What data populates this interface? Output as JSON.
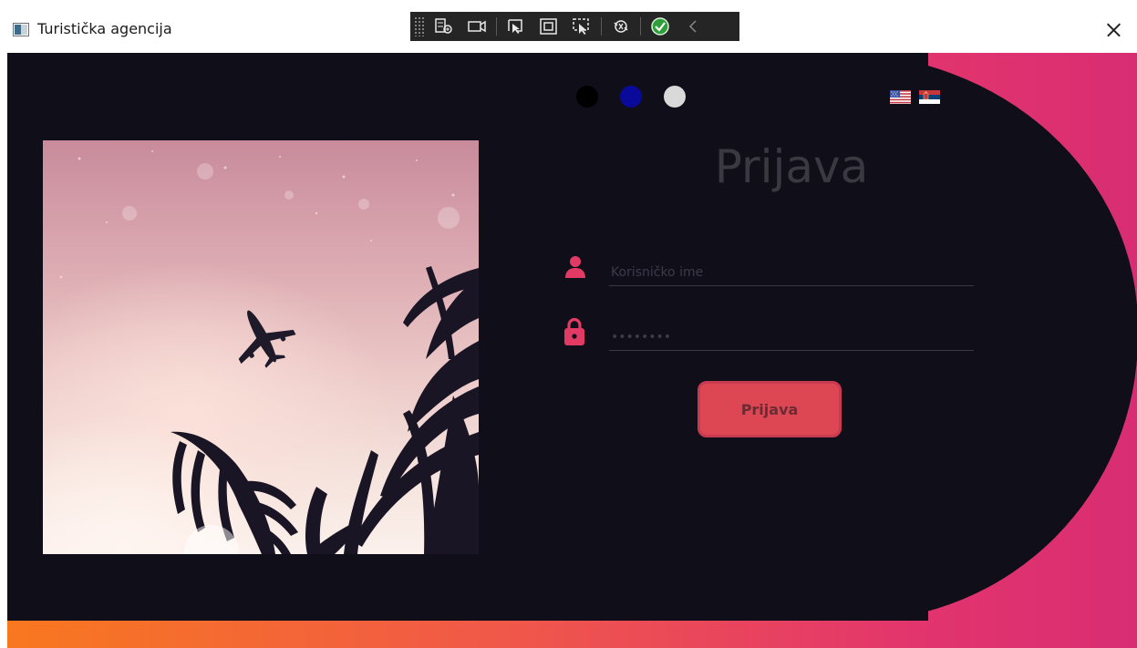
{
  "window": {
    "title": "Turistička agencija"
  },
  "debug_toolbar": {
    "icons": [
      "live-visual-tree-icon",
      "record-icon",
      "select-element-icon",
      "display-layout-adorners-icon",
      "track-focused-element-icon",
      "hot-reload-icon",
      "binding-ok-icon",
      "collapse-icon"
    ]
  },
  "theme": {
    "dots": [
      {
        "name": "black",
        "color": "#000000"
      },
      {
        "name": "blue",
        "color": "#0a0a9a"
      },
      {
        "name": "white",
        "color": "#d9d9d9"
      }
    ]
  },
  "languages": [
    "us-flag-icon",
    "rs-flag-icon"
  ],
  "login": {
    "heading": "Prijava",
    "username_placeholder": "Korisničko ime",
    "password_placeholder": "••••••••",
    "button_label": "Prijava"
  },
  "colors": {
    "background_dark": "#100e18",
    "accent": "#e03a65",
    "button": "#dd4754",
    "gradient_start": "#f8781f",
    "gradient_end": "#d92d73"
  }
}
